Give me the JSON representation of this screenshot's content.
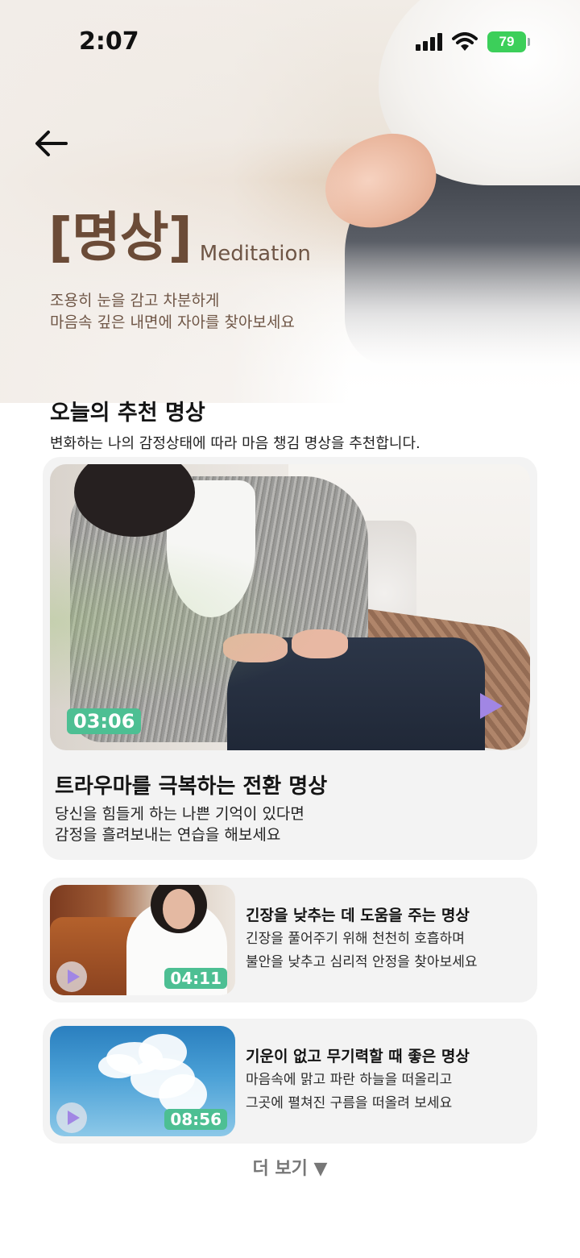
{
  "status": {
    "time": "2:07",
    "battery": "79"
  },
  "hero": {
    "title_ko": "[명상]",
    "title_en": "Meditation",
    "subtitle_line1": "조용히 눈을 감고 차분하게",
    "subtitle_line2": "마음속 깊은 내면에 자아를 찾아보세요"
  },
  "section": {
    "title": "오늘의 추천 명상",
    "desc": "변화하는 나의 감정상태에 따라 마음 챙김 명상을 추천합니다."
  },
  "featured": {
    "duration": "03:06",
    "title": "트라우마를 극복하는 전환 명상",
    "desc_line1": "당신을 힘들게 하는 나쁜 기억이 있다면",
    "desc_line2": "감정을 흘려보내는 연습을 해보세요"
  },
  "list": [
    {
      "duration": "04:11",
      "title": "긴장을 낮추는 데 도움을 주는 명상",
      "desc_line1": "긴장을 풀어주기 위해 천천히 호흡하며",
      "desc_line2": "불안을 낮추고 심리적 안정을 찾아보세요"
    },
    {
      "duration": "08:56",
      "title": "기운이 없고 무기력할 때 좋은 명상",
      "desc_line1": "마음속에 맑고 파란 하늘을 떠올리고",
      "desc_line2": "그곳에 펼쳐진 구름을 떠올려 보세요"
    }
  ],
  "more_label": "더 보기 ▼",
  "colors": {
    "accent_brown": "#6b4b37",
    "badge_green": "#4dbf93",
    "play_purple": "#a186e4",
    "card_bg": "#f3f3f3"
  }
}
